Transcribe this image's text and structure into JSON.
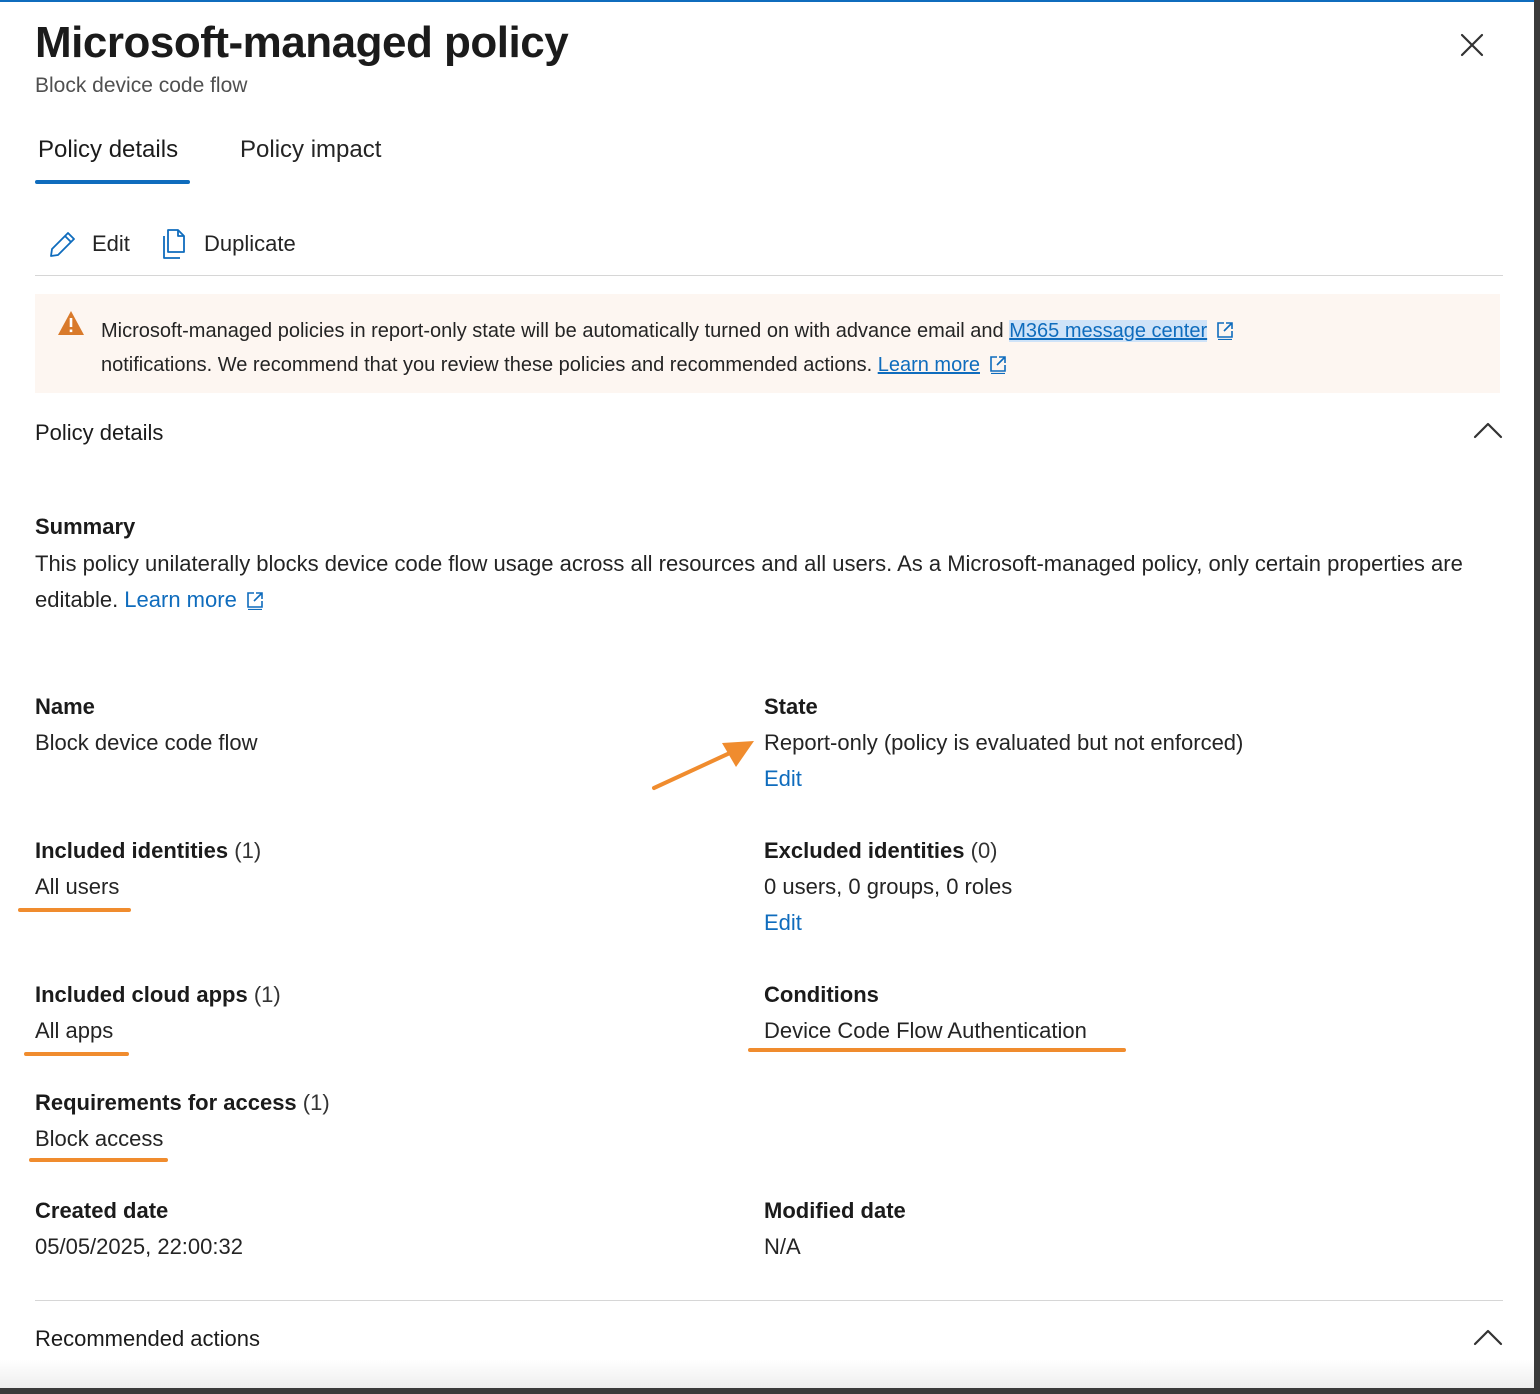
{
  "header": {
    "title": "Microsoft-managed policy",
    "subtitle": "Block device code flow"
  },
  "tabs": [
    {
      "label": "Policy details",
      "active": true
    },
    {
      "label": "Policy impact",
      "active": false
    }
  ],
  "toolbar": {
    "edit_label": "Edit",
    "duplicate_label": "Duplicate"
  },
  "banner": {
    "text_before": "Microsoft-managed policies in report-only state will be automatically turned on with advance email and ",
    "link1": "M365 message center",
    "text_after": "notifications. We recommend that you review these policies and recommended actions. ",
    "link2": "Learn more"
  },
  "policy_details": {
    "section_title": "Policy details",
    "summary_label": "Summary",
    "summary_text": "This policy unilaterally blocks device code flow usage across all resources and all users. As a Microsoft-managed policy, only certain properties are editable. ",
    "summary_link": "Learn more",
    "name_label": "Name",
    "name_value": "Block device code flow",
    "state_label": "State",
    "state_value": "Report-only (policy is evaluated but not enforced)",
    "state_edit": "Edit",
    "included_identities_label": "Included identities",
    "included_identities_count": "(1)",
    "included_identities_value": "All users",
    "excluded_identities_label": "Excluded identities",
    "excluded_identities_count": "(0)",
    "excluded_identities_value": "0 users, 0 groups, 0 roles",
    "excluded_edit": "Edit",
    "included_apps_label": "Included cloud apps",
    "included_apps_count": "(1)",
    "included_apps_value": "All apps",
    "conditions_label": "Conditions",
    "conditions_value": "Device Code Flow Authentication",
    "requirements_label": "Requirements for access",
    "requirements_count": "(1)",
    "requirements_value": "Block access",
    "created_label": "Created date",
    "created_value": "05/05/2025, 22:00:32",
    "modified_label": "Modified date",
    "modified_value": "N/A"
  },
  "recommended": {
    "section_title": "Recommended actions"
  },
  "colors": {
    "accent": "#0f6cbd",
    "annotation": "#f08c2e",
    "warning": "#d97a2b",
    "banner_bg": "#fdf6f1"
  }
}
